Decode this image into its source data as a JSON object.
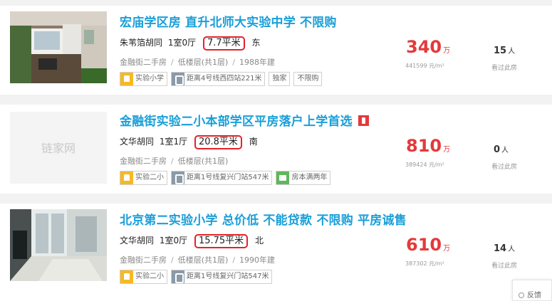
{
  "listings": [
    {
      "title": "宏庙学区房 直升北师大实验中学 不限购",
      "hot_badge": false,
      "location": "朱苇箔胡同",
      "layout": "1室0厅",
      "area": "7.7平米",
      "orientation": "东",
      "district": "金融街二手房",
      "floor": "低楼层(共1层)",
      "year": "1988年建",
      "tags": [
        {
          "icon": "school-icon",
          "text": "实验小学"
        },
        {
          "icon": "subway-icon",
          "text": "距离4号线西四站221米"
        },
        {
          "icon": "",
          "text": "独家"
        },
        {
          "icon": "",
          "text": "不限购"
        }
      ],
      "price": "340",
      "price_unit": "万",
      "unit_price": "441599 元/m²",
      "visitors": "15",
      "visitors_unit": "人",
      "visit_label": "看过此房"
    },
    {
      "title": "金融街实验二小本部学区平房落户上学首选",
      "hot_badge": true,
      "location": "文华胡同",
      "layout": "1室1厅",
      "area": "20.8平米",
      "orientation": "南",
      "district": "金融街二手房",
      "floor": "低楼层(共1层)",
      "year": "",
      "tags": [
        {
          "icon": "school-icon",
          "text": "实验二小"
        },
        {
          "icon": "subway-icon",
          "text": "距离1号线复兴门站547米"
        },
        {
          "icon": "tax-icon",
          "text": "房本满两年"
        }
      ],
      "price": "810",
      "price_unit": "万",
      "unit_price": "389424 元/m²",
      "visitors": "0",
      "visitors_unit": "人",
      "visit_label": "看过此房"
    },
    {
      "title": "北京第二实验小学 总价低 不能贷款 不限购 平房诚售",
      "hot_badge": false,
      "location": "文华胡同",
      "layout": "1室0厅",
      "area": "15.75平米",
      "orientation": "北",
      "district": "金融街二手房",
      "floor": "低楼层(共1层)",
      "year": "1990年建",
      "tags": [
        {
          "icon": "school-icon",
          "text": "实验二小"
        },
        {
          "icon": "subway-icon",
          "text": "距离1号线复兴门站547米"
        }
      ],
      "price": "610",
      "price_unit": "万",
      "unit_price": "387302 元/m²",
      "visitors": "14",
      "visitors_unit": "人",
      "visit_label": "看过此房"
    }
  ],
  "placeholder_logo": "链家网",
  "float_widget_label": "反馈",
  "colors": {
    "title": "#1a9fd8",
    "price": "#e4393c",
    "area_highlight": "#e4222a",
    "school_tag": "#f6b824",
    "subway_tag": "#8a9aa8",
    "tax_tag": "#5fb85a"
  }
}
